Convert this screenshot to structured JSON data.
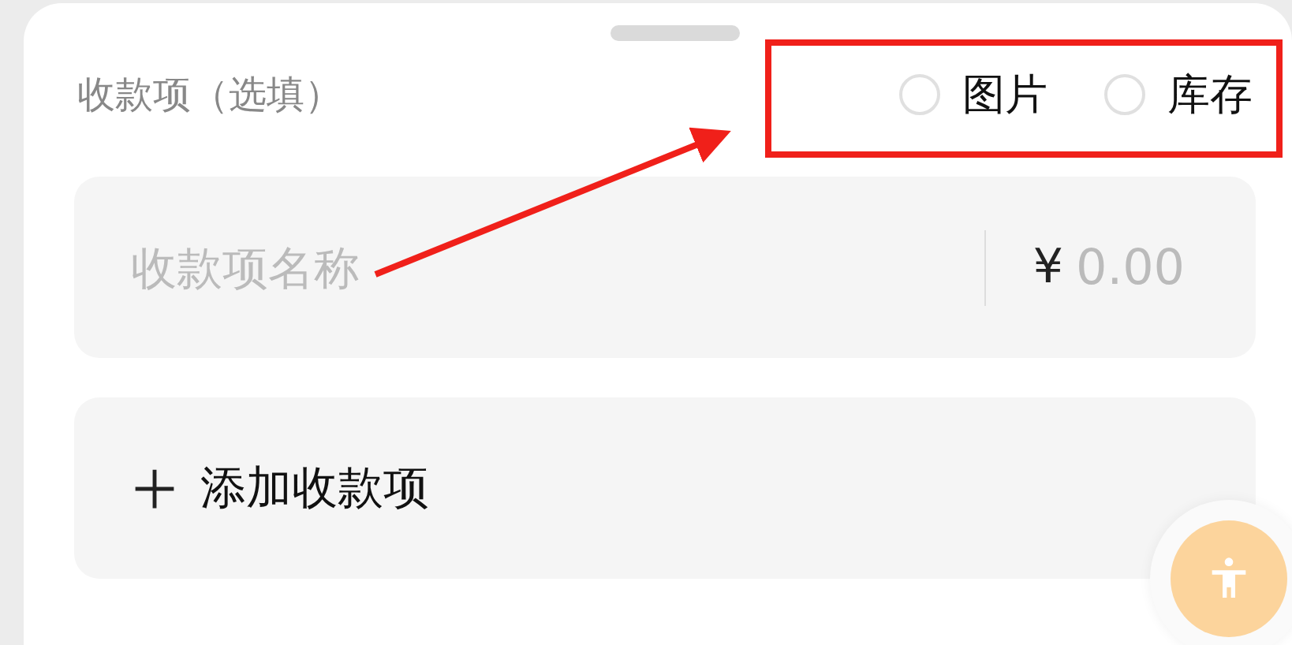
{
  "section": {
    "label": "收款项（选填）"
  },
  "options": [
    {
      "label": "图片",
      "checked": false
    },
    {
      "label": "库存",
      "checked": false
    }
  ],
  "item_field": {
    "placeholder": "收款项名称",
    "currency": "¥",
    "amount_placeholder": "0.00"
  },
  "add_button": {
    "label": "添加收款项"
  }
}
